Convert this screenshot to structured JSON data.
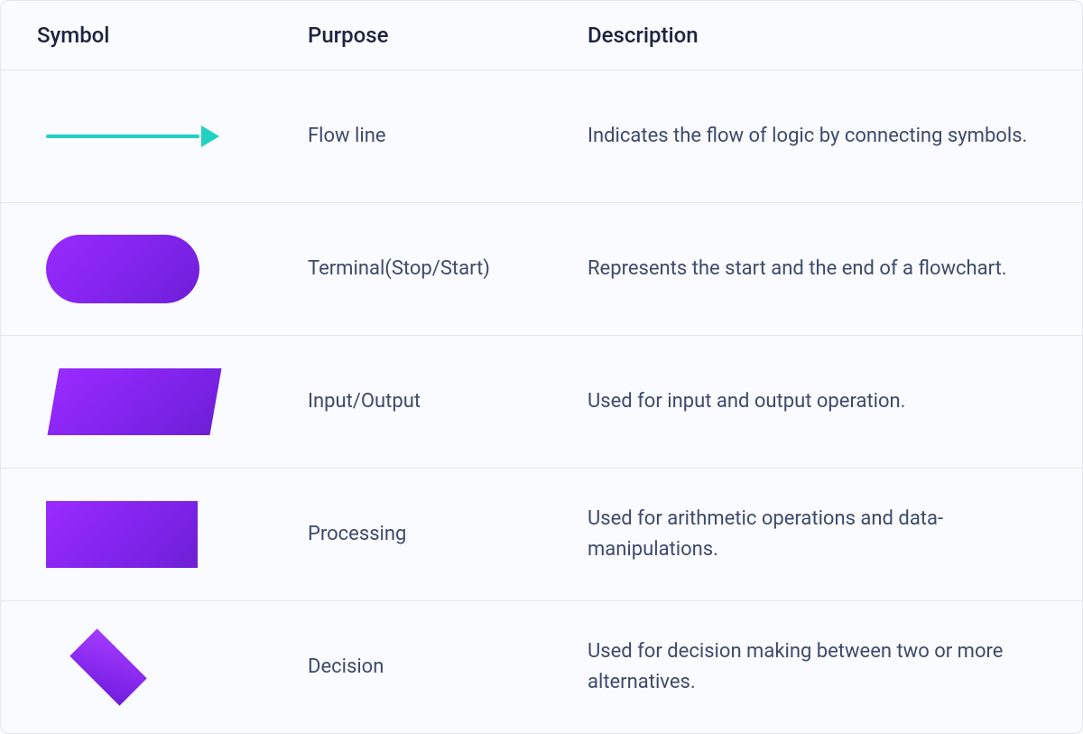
{
  "header": {
    "symbol": "Symbol",
    "purpose": "Purpose",
    "description": "Description"
  },
  "rows": [
    {
      "icon": "flow-line-arrow-icon",
      "purpose": "Flow line",
      "description": "Indicates the flow of logic by connecting symbols."
    },
    {
      "icon": "terminal-pill-icon",
      "purpose": "Terminal(Stop/Start)",
      "description": "Represents the start and the end of a flowchart."
    },
    {
      "icon": "parallelogram-icon",
      "purpose": "Input/Output",
      "description": "Used for input and output operation."
    },
    {
      "icon": "rectangle-icon",
      "purpose": "Processing",
      "description": "Used for arithmetic operations and data-manipulations."
    },
    {
      "icon": "diamond-icon",
      "purpose": "Decision",
      "description": "Used for decision making between two or more alternatives."
    }
  ],
  "colors": {
    "accent_shape": "#7a22e6",
    "arrow": "#1fd2c1",
    "text_heading": "#1c2440",
    "text_body": "#3e4a6b",
    "border": "#e3e6ed",
    "bg": "#f9fbff"
  }
}
